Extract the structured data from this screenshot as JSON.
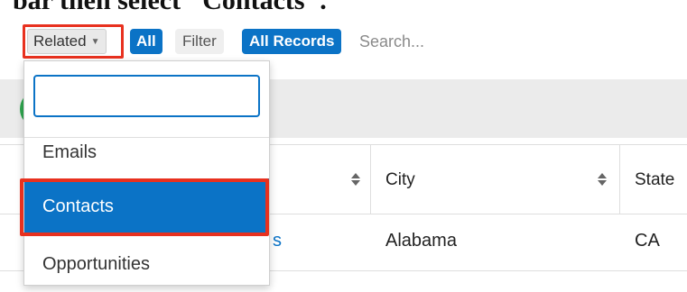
{
  "caption": "bar then select \"Contacts\".",
  "toolbar": {
    "related_label": "Related",
    "all_label": "All",
    "filter_label": "Filter",
    "all_records_label": "All Records",
    "search_placeholder": "Search..."
  },
  "dropdown": {
    "search_value": "",
    "items": [
      "Emails",
      "Contacts",
      "Opportunities"
    ],
    "selected": "Contacts"
  },
  "table": {
    "headers": [
      "City",
      "State"
    ],
    "row": {
      "name_partial": "s",
      "city": "Alabama",
      "state": "CA"
    }
  },
  "colors": {
    "accent": "#0b73c6",
    "highlight": "#e8311f",
    "status_green": "#2fa84f"
  }
}
